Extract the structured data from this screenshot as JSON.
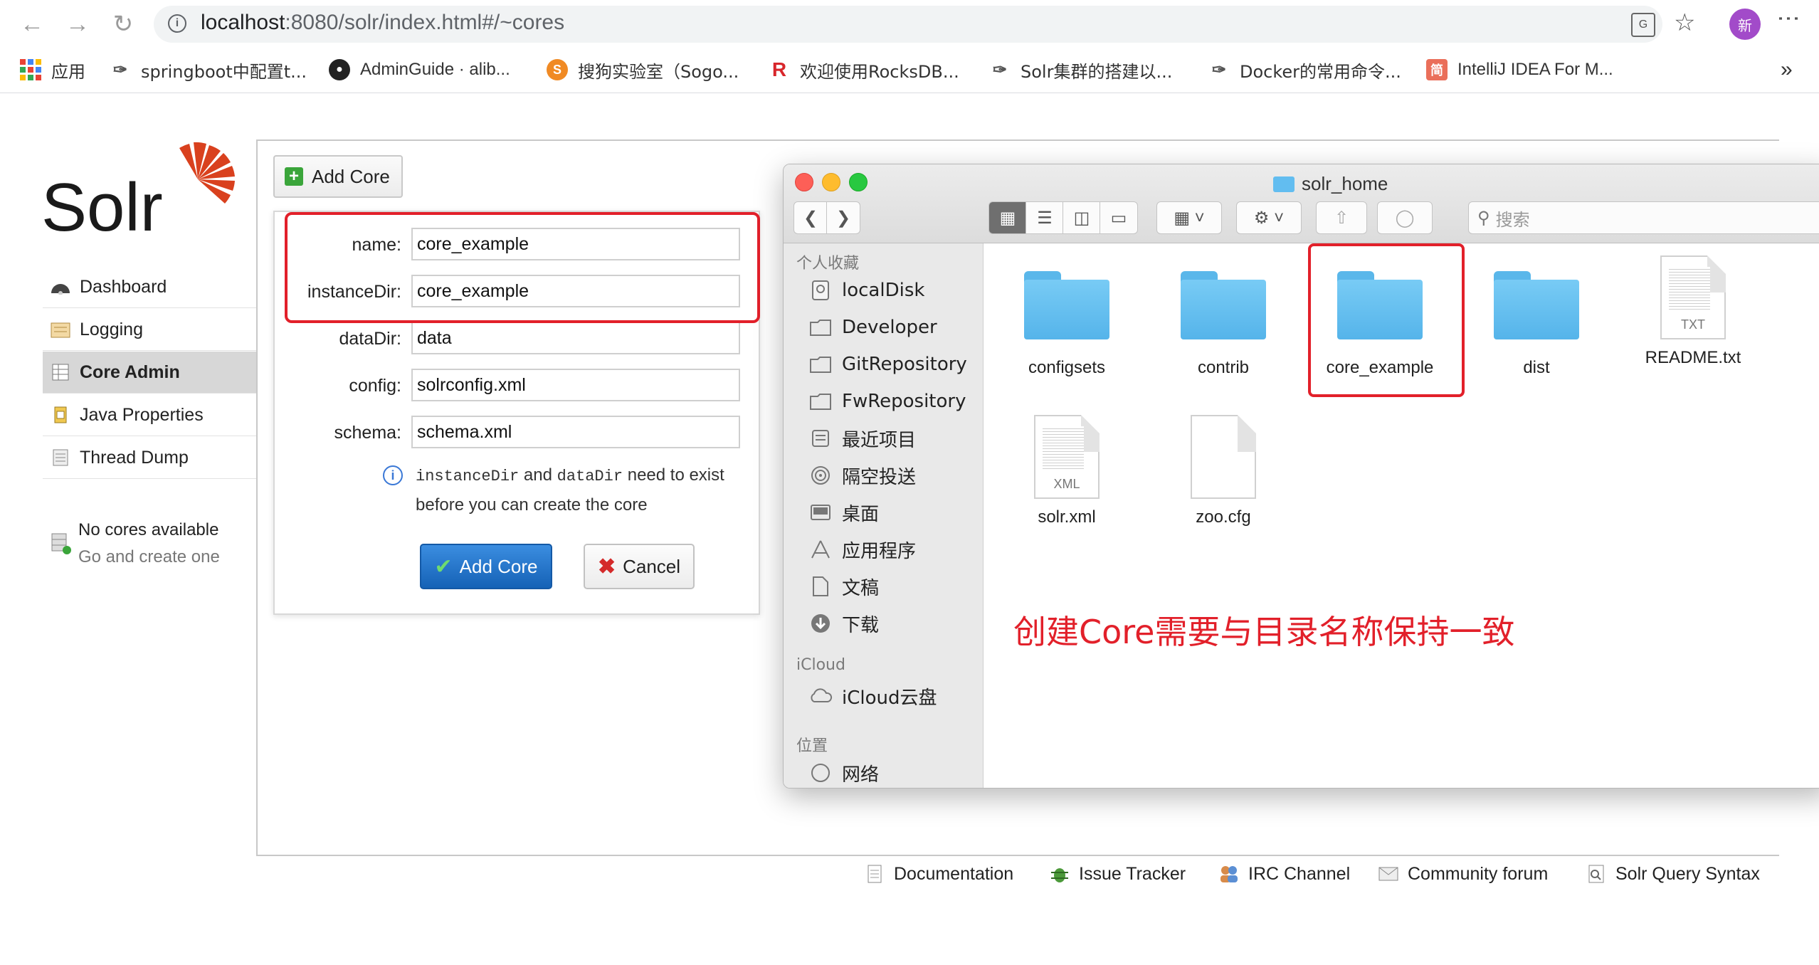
{
  "browser": {
    "url_host": "localhost",
    "url_rest": ":8080/solr/index.html#/~cores",
    "profile_initial": "新",
    "bookmarks": [
      {
        "label": "应用"
      },
      {
        "label": "springboot中配置t..."
      },
      {
        "label": "AdminGuide · alib..."
      },
      {
        "label": "搜狗实验室（Sogo..."
      },
      {
        "label": "欢迎使用RocksDB..."
      },
      {
        "label": "Solr集群的搭建以..."
      },
      {
        "label": "Docker的常用命令..."
      },
      {
        "label": "IntelliJ IDEA For M..."
      }
    ],
    "overflow": "»"
  },
  "solr": {
    "logo_text": "Solr",
    "nav": [
      {
        "label": "Dashboard"
      },
      {
        "label": "Logging"
      },
      {
        "label": "Core Admin",
        "active": true
      },
      {
        "label": "Java Properties"
      },
      {
        "label": "Thread Dump"
      }
    ],
    "no_cores": "No cores available",
    "no_cores_sub": "Go and create one",
    "add_core_button": "Add Core",
    "form": {
      "name_label": "name:",
      "name_value": "core_example",
      "instance_label": "instanceDir:",
      "instance_value": "core_example",
      "datadir_label": "dataDir:",
      "datadir_value": "data",
      "config_label": "config:",
      "config_value": "solrconfig.xml",
      "schema_label": "schema:",
      "schema_value": "schema.xml",
      "hint_code1": "instanceDir",
      "hint_and": " and ",
      "hint_code2": "dataDir",
      "hint_rest": " need to exist before you can create the core",
      "submit": "Add Core",
      "cancel": "Cancel"
    },
    "footer": [
      {
        "label": "Documentation"
      },
      {
        "label": "Issue Tracker"
      },
      {
        "label": "IRC Channel"
      },
      {
        "label": "Community forum"
      },
      {
        "label": "Solr Query Syntax"
      }
    ]
  },
  "finder": {
    "title": "solr_home",
    "search_placeholder": "搜索",
    "sidebar": {
      "favorites_heading": "个人收藏",
      "favorites": [
        {
          "label": "localDisk"
        },
        {
          "label": "Developer"
        },
        {
          "label": "GitRepository"
        },
        {
          "label": "FwRepository"
        },
        {
          "label": "最近项目"
        },
        {
          "label": "隔空投送"
        },
        {
          "label": "桌面"
        },
        {
          "label": "应用程序"
        },
        {
          "label": "文稿"
        },
        {
          "label": "下载"
        }
      ],
      "icloud_heading": "iCloud",
      "icloud": [
        {
          "label": "iCloud云盘"
        }
      ],
      "locations_heading": "位置",
      "locations": [
        {
          "label": "网络"
        }
      ]
    },
    "files": [
      {
        "name": "configsets",
        "kind": "folder"
      },
      {
        "name": "contrib",
        "kind": "folder"
      },
      {
        "name": "core_example",
        "kind": "folder"
      },
      {
        "name": "dist",
        "kind": "folder"
      },
      {
        "name": "README.txt",
        "kind": "doc",
        "tag": "TXT"
      },
      {
        "name": "solr.xml",
        "kind": "doc",
        "tag": "XML"
      },
      {
        "name": "zoo.cfg",
        "kind": "blank"
      }
    ],
    "annotation": "创建Core需要与目录名称保持一致"
  },
  "colors": {
    "highlight_red": "#e2202a",
    "solr_logo_red": "#d9411e",
    "primary_button": "#1f6fc5",
    "folder_blue": "#62bdf0"
  }
}
